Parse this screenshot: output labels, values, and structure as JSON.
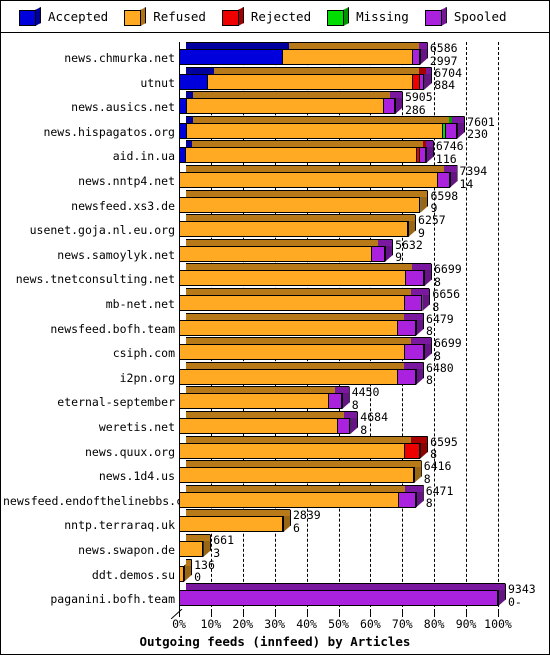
{
  "legend": {
    "items": [
      {
        "label": "Accepted",
        "color": "#0000dd",
        "name": "accepted"
      },
      {
        "label": "Refused",
        "color": "#ffaa22",
        "name": "refused"
      },
      {
        "label": "Rejected",
        "color": "#ee0000",
        "name": "rejected"
      },
      {
        "label": "Missing",
        "color": "#00dd00",
        "name": "missing"
      },
      {
        "label": "Spooled",
        "color": "#aa22dd",
        "name": "spooled"
      }
    ]
  },
  "axis": {
    "title": "Outgoing feeds (innfeed) by Articles",
    "xticks": [
      "0%",
      "10%",
      "20%",
      "30%",
      "40%",
      "50%",
      "60%",
      "70%",
      "80%",
      "90%",
      "100%"
    ],
    "xmin": 0,
    "xmax": 100
  },
  "chart_data": {
    "type": "bar",
    "orientation": "horizontal",
    "stacked": true,
    "title": "Outgoing feeds (innfeed) by Articles",
    "xlabel": "Outgoing feeds (innfeed) by Articles",
    "ylabel": "",
    "xlim": [
      0,
      100
    ],
    "xtick_labels": [
      "0%",
      "10%",
      "20%",
      "30%",
      "40%",
      "50%",
      "60%",
      "70%",
      "80%",
      "90%",
      "100%"
    ],
    "grid": "vertical-dashed",
    "legend_position": "top",
    "series": [
      {
        "name": "Accepted",
        "color": "#0000dd"
      },
      {
        "name": "Refused",
        "color": "#ffaa22"
      },
      {
        "name": "Rejected",
        "color": "#ee0000"
      },
      {
        "name": "Missing",
        "color": "#00dd00"
      },
      {
        "name": "Spooled",
        "color": "#aa22dd"
      }
    ],
    "categories": [
      "news.chmurka.net",
      "utnut",
      "news.ausics.net",
      "news.hispagatos.org",
      "aid.in.ua",
      "news.nntp4.net",
      "newsfeed.xs3.de",
      "usenet.goja.nl.eu.org",
      "news.samoylyk.net",
      "news.tnetconsulting.net",
      "mb-net.net",
      "newsfeed.bofh.team",
      "csiph.com",
      "i2pn.org",
      "eternal-september",
      "weretis.net",
      "news.quux.org",
      "news.1d4.us",
      "newsfeed.endofthelinebbs.com",
      "nntp.terraraq.uk",
      "news.swapon.de",
      "ddt.demos.su",
      "paganini.bofh.team"
    ],
    "rows": [
      {
        "label": "news.chmurka.net",
        "value1": "6586",
        "value2": "2997",
        "total_pct": 75.5,
        "segments": [
          {
            "s": "Accepted",
            "pct": 32.3
          },
          {
            "s": "Refused",
            "pct": 40.6
          },
          {
            "s": "Spooled",
            "pct": 2.6
          }
        ]
      },
      {
        "label": "utnut",
        "value1": "6704",
        "value2": "884",
        "total_pct": 76.9,
        "segments": [
          {
            "s": "Accepted",
            "pct": 8.8
          },
          {
            "s": "Refused",
            "pct": 64.3
          },
          {
            "s": "Rejected",
            "pct": 2.0
          },
          {
            "s": "Spooled",
            "pct": 1.8
          }
        ]
      },
      {
        "label": "news.ausics.net",
        "value1": "5905",
        "value2": "286",
        "total_pct": 67.7,
        "segments": [
          {
            "s": "Accepted",
            "pct": 2.3
          },
          {
            "s": "Refused",
            "pct": 61.8
          },
          {
            "s": "Spooled",
            "pct": 3.6
          }
        ]
      },
      {
        "label": "news.hispagatos.org",
        "value1": "7601",
        "value2": "230",
        "total_pct": 87.2,
        "segments": [
          {
            "s": "Accepted",
            "pct": 2.2
          },
          {
            "s": "Refused",
            "pct": 80.3
          },
          {
            "s": "Missing",
            "pct": 1.0
          },
          {
            "s": "Spooled",
            "pct": 3.7
          }
        ]
      },
      {
        "label": "aid.in.ua",
        "value1": "6746",
        "value2": "116",
        "total_pct": 77.4,
        "segments": [
          {
            "s": "Accepted",
            "pct": 2.0
          },
          {
            "s": "Refused",
            "pct": 72.2
          },
          {
            "s": "Rejected",
            "pct": 1.0
          },
          {
            "s": "Spooled",
            "pct": 2.2
          }
        ]
      },
      {
        "label": "news.nntp4.net",
        "value1": "7394",
        "value2": "14",
        "total_pct": 84.8,
        "segments": [
          {
            "s": "Refused",
            "pct": 80.8
          },
          {
            "s": "Spooled",
            "pct": 4.0
          }
        ]
      },
      {
        "label": "newsfeed.xs3.de",
        "value1": "6598",
        "value2": "9",
        "total_pct": 75.7,
        "segments": [
          {
            "s": "Refused",
            "pct": 75.7
          }
        ]
      },
      {
        "label": "usenet.goja.nl.eu.org",
        "value1": "6257",
        "value2": "9",
        "total_pct": 71.8,
        "segments": [
          {
            "s": "Refused",
            "pct": 71.8
          }
        ]
      },
      {
        "label": "news.samoylyk.net",
        "value1": "5632",
        "value2": "9",
        "total_pct": 64.6,
        "segments": [
          {
            "s": "Refused",
            "pct": 60.3
          },
          {
            "s": "Spooled",
            "pct": 4.3
          }
        ]
      },
      {
        "label": "news.tnetconsulting.net",
        "value1": "6699",
        "value2": "8",
        "total_pct": 76.8,
        "segments": [
          {
            "s": "Refused",
            "pct": 70.7
          },
          {
            "s": "Spooled",
            "pct": 6.1
          }
        ]
      },
      {
        "label": "mb-net.net",
        "value1": "6656",
        "value2": "8",
        "total_pct": 76.3,
        "segments": [
          {
            "s": "Refused",
            "pct": 70.6
          },
          {
            "s": "Spooled",
            "pct": 5.7
          }
        ]
      },
      {
        "label": "newsfeed.bofh.team",
        "value1": "6479",
        "value2": "8",
        "total_pct": 74.3,
        "segments": [
          {
            "s": "Refused",
            "pct": 68.4
          },
          {
            "s": "Spooled",
            "pct": 5.9
          }
        ]
      },
      {
        "label": "csiph.com",
        "value1": "6699",
        "value2": "8",
        "total_pct": 76.8,
        "segments": [
          {
            "s": "Refused",
            "pct": 70.6
          },
          {
            "s": "Spooled",
            "pct": 6.2
          }
        ]
      },
      {
        "label": "i2pn.org",
        "value1": "6480",
        "value2": "8",
        "total_pct": 74.3,
        "segments": [
          {
            "s": "Refused",
            "pct": 68.3
          },
          {
            "s": "Spooled",
            "pct": 6.0
          }
        ]
      },
      {
        "label": "eternal-september",
        "value1": "4450",
        "value2": "8",
        "total_pct": 51.0,
        "segments": [
          {
            "s": "Refused",
            "pct": 46.6
          },
          {
            "s": "Spooled",
            "pct": 4.4
          }
        ]
      },
      {
        "label": "weretis.net",
        "value1": "4684",
        "value2": "8",
        "total_pct": 53.7,
        "segments": [
          {
            "s": "Refused",
            "pct": 49.5
          },
          {
            "s": "Spooled",
            "pct": 4.2
          }
        ]
      },
      {
        "label": "news.quux.org",
        "value1": "6595",
        "value2": "8",
        "total_pct": 75.6,
        "segments": [
          {
            "s": "Refused",
            "pct": 70.4
          },
          {
            "s": "Rejected",
            "pct": 5.2
          }
        ]
      },
      {
        "label": "news.1d4.us",
        "value1": "6416",
        "value2": "8",
        "total_pct": 73.6,
        "segments": [
          {
            "s": "Refused",
            "pct": 73.6
          }
        ]
      },
      {
        "label": "newsfeed.endofthelinebbs.com",
        "value1": "6471",
        "value2": "8",
        "total_pct": 74.2,
        "segments": [
          {
            "s": "Refused",
            "pct": 68.5
          },
          {
            "s": "Spooled",
            "pct": 5.7
          }
        ]
      },
      {
        "label": "nntp.terraraq.uk",
        "value1": "2839",
        "value2": "6",
        "total_pct": 32.6,
        "segments": [
          {
            "s": "Refused",
            "pct": 32.6
          }
        ]
      },
      {
        "label": "news.swapon.de",
        "value1": "661",
        "value2": "3",
        "total_pct": 7.6,
        "segments": [
          {
            "s": "Refused",
            "pct": 7.6
          }
        ]
      },
      {
        "label": "ddt.demos.su",
        "value1": "136",
        "value2": "0",
        "total_pct": 1.6,
        "segments": [
          {
            "s": "Refused",
            "pct": 1.6
          }
        ]
      },
      {
        "label": "paganini.bofh.team",
        "value1": "9343",
        "value2": "0-",
        "total_pct": 100.0,
        "segments": [
          {
            "s": "Spooled",
            "pct": 100.0
          }
        ]
      }
    ]
  }
}
